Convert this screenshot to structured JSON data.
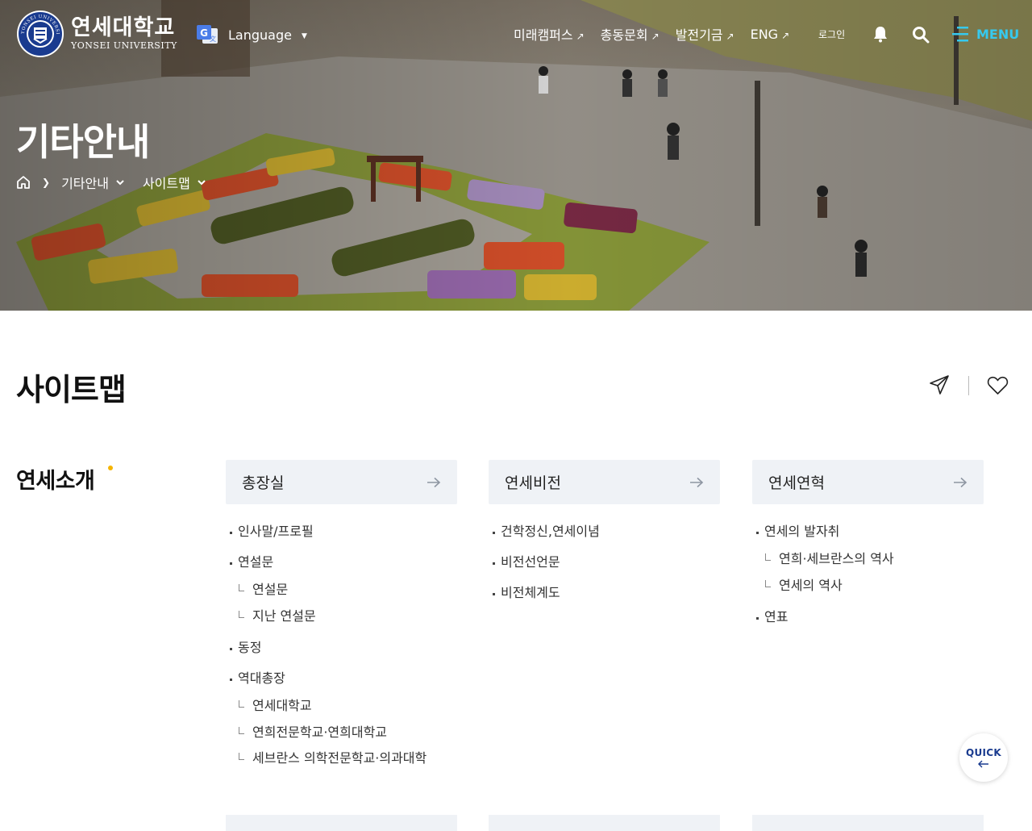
{
  "header": {
    "logo": {
      "kor": "연세대학교",
      "eng": "YONSEI UNIVERSITY",
      "seal_text": "YONSEI UNIVERSITY"
    },
    "language": {
      "label": "Language"
    },
    "nav": [
      {
        "label": "미래캠퍼스"
      },
      {
        "label": "총동문회"
      },
      {
        "label": "발전기금"
      },
      {
        "label": "ENG"
      }
    ],
    "login_label": "로그인",
    "menu_label": "MENU"
  },
  "hero": {
    "title": "기타안내",
    "breadcrumb": {
      "level1": "기타안내",
      "level2": "사이트맵"
    }
  },
  "page": {
    "title": "사이트맵"
  },
  "section": {
    "title": "연세소개",
    "columns": [
      {
        "label": "총장실",
        "items": [
          {
            "label": "인사말/프로필"
          },
          {
            "label": "연설문",
            "subs": [
              "연설문",
              "지난 연설문"
            ]
          },
          {
            "label": "동정"
          },
          {
            "label": "역대총장",
            "subs": [
              "연세대학교",
              "연희전문학교·연희대학교",
              "세브란스 의학전문학교·의과대학"
            ]
          }
        ]
      },
      {
        "label": "연세비전",
        "items": [
          {
            "label": "건학정신,연세이념"
          },
          {
            "label": "비전선언문"
          },
          {
            "label": "비전체계도"
          }
        ]
      },
      {
        "label": "연세연혁",
        "items": [
          {
            "label": "연세의 발자취",
            "subs": [
              "연희·세브란스의 역사",
              "연세의 역사"
            ]
          },
          {
            "label": "연표"
          }
        ]
      }
    ]
  },
  "quick": {
    "label": "QUICK"
  },
  "colors": {
    "accent": "#36c9ee",
    "navy": "#1a3b8f",
    "dot": "#f5b400",
    "panel": "#eff2f6"
  },
  "icons": [
    "google-translate-icon",
    "bell-icon",
    "search-icon",
    "hamburger-icon",
    "home-icon",
    "chevron-down-icon",
    "share-icon",
    "heart-icon",
    "arrow-right-icon",
    "arrow-left-icon"
  ]
}
